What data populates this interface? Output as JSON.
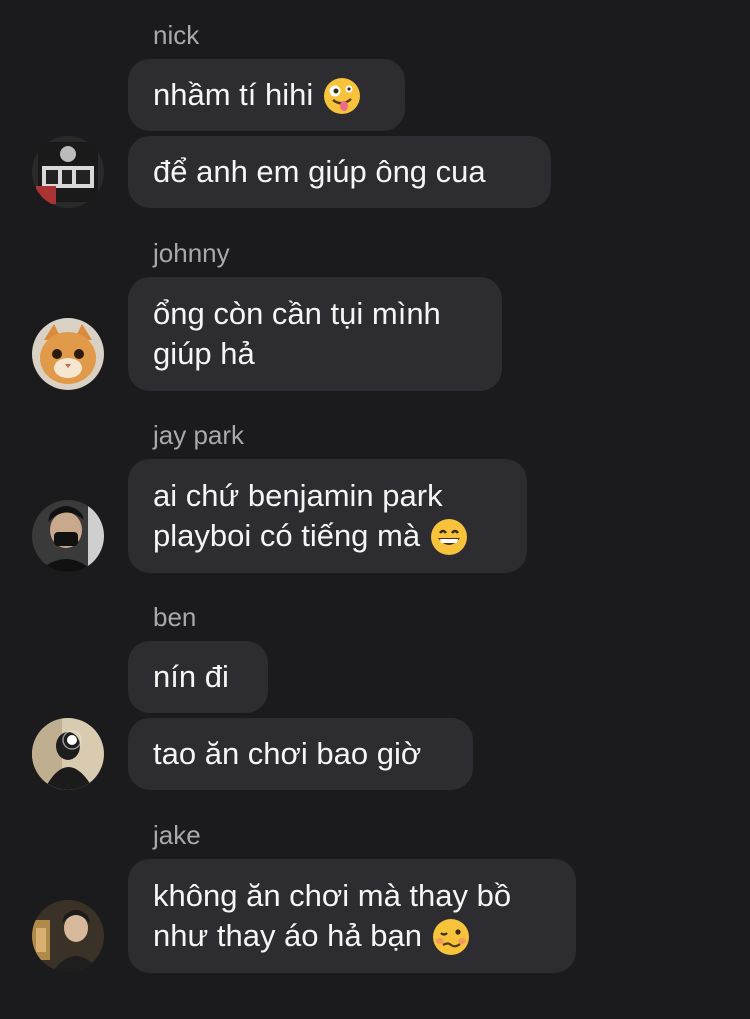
{
  "messages": [
    {
      "sender": "nick",
      "bubbles": [
        {
          "lines": [
            "nhầm tí hihi"
          ],
          "emoji": "zany-face-emoji"
        },
        {
          "lines": [
            "để anh em giúp ông cua"
          ]
        }
      ]
    },
    {
      "sender": "johnny",
      "bubbles": [
        {
          "lines": [
            "ổng còn cần tụi mình",
            "giúp hả"
          ]
        }
      ]
    },
    {
      "sender": "jay park",
      "bubbles": [
        {
          "lines": [
            "ai chứ benjamin park",
            "playboi có tiếng mà"
          ],
          "emoji": "grinning-face-emoji"
        }
      ]
    },
    {
      "sender": "ben",
      "bubbles": [
        {
          "lines": [
            "nín đi"
          ]
        },
        {
          "lines": [
            "tao ăn chơi bao giờ"
          ]
        }
      ]
    },
    {
      "sender": "jake",
      "bubbles": [
        {
          "lines": [
            "không ăn chơi mà thay bồ",
            "như thay áo hả bạn"
          ],
          "emoji": "woozy-face-emoji"
        }
      ]
    }
  ],
  "colors": {
    "background": "#1b1b1e",
    "bubble": "#2d2d31",
    "sender_text": "#a8a8ad",
    "message_text": "#f5f5f5"
  }
}
